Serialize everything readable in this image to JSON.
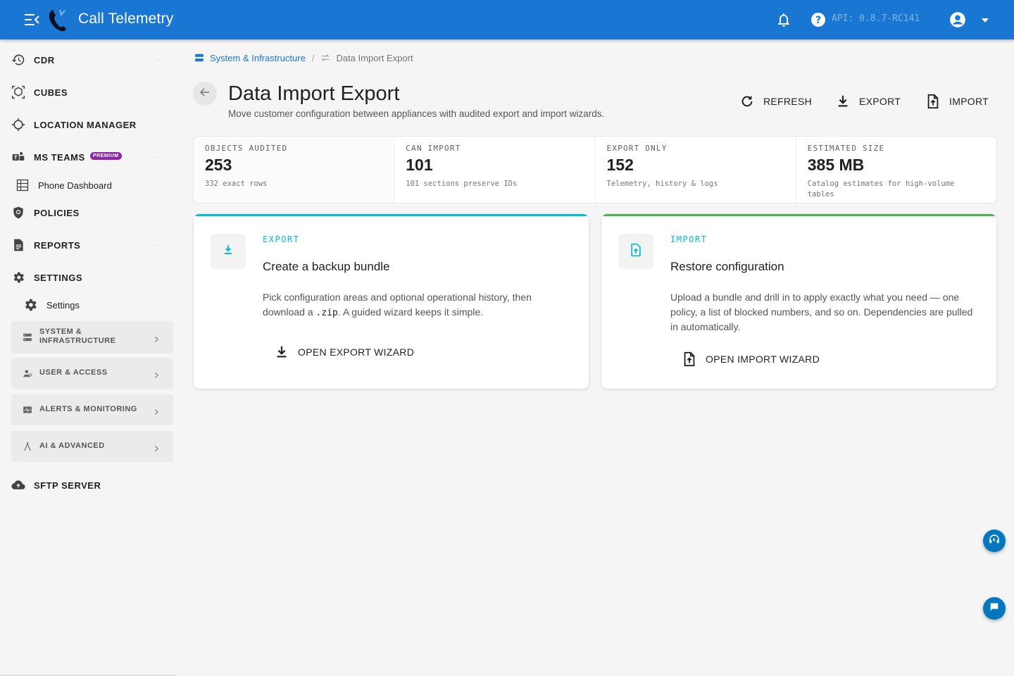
{
  "app": {
    "title": "Call Telemetry",
    "api_version": "API: 0.8.7-RC141"
  },
  "sidebar": {
    "cdr": "CDR",
    "cubes": "CUBES",
    "location_manager": "LOCATION MANAGER",
    "ms_teams": "MS TEAMS",
    "premium_badge": "PREMIUM",
    "phone_dashboard": "Phone Dashboard",
    "policies": "POLICIES",
    "reports": "REPORTS",
    "settings": "SETTINGS",
    "settings_sub": "Settings",
    "groups": [
      {
        "label": "SYSTEM & INFRASTRUCTURE",
        "line1": "SYSTEM &",
        "line2": "INFRASTRUCTURE"
      },
      {
        "label": "USER & ACCESS"
      },
      {
        "label": "ALERTS & MONITORING"
      },
      {
        "label": "AI & ADVANCED"
      }
    ],
    "sftp": "SFTP SERVER"
  },
  "breadcrumb": {
    "parent": "System & Infrastructure",
    "separator": "/",
    "current": "Data Import Export"
  },
  "page": {
    "title": "Data Import Export",
    "subtitle": "Move customer configuration between appliances with audited export and import wizards."
  },
  "actions": {
    "refresh": "REFRESH",
    "export": "EXPORT",
    "import": "IMPORT"
  },
  "stats": [
    {
      "label": "OBJECTS AUDITED",
      "value": "253",
      "note": "332 exact rows"
    },
    {
      "label": "CAN IMPORT",
      "value": "101",
      "note": "101 sections preserve IDs"
    },
    {
      "label": "EXPORT ONLY",
      "value": "152",
      "note": "Telemetry, history & logs"
    },
    {
      "label": "ESTIMATED SIZE",
      "value": "385 MB",
      "note": "Catalog estimates for high-volume tables"
    }
  ],
  "export_card": {
    "eyebrow": "EXPORT",
    "title": "Create a backup bundle",
    "desc_before": "Pick configuration areas and optional operational history, then download a ",
    "desc_code": ".zip",
    "desc_after": ". A guided wizard keeps it simple.",
    "button": "OPEN EXPORT WIZARD"
  },
  "import_card": {
    "eyebrow": "IMPORT",
    "title": "Restore configuration",
    "desc": "Upload a bundle and drill in to apply exactly what you need — one policy, a list of blocked numbers, and so on. Dependencies are pulled in automatically.",
    "button": "OPEN IMPORT WIZARD"
  },
  "colors": {
    "primary": "#1976d2",
    "export_accent": "#00bcd4",
    "import_accent": "#4caf50",
    "premium": "#8e24aa",
    "fab": "#0277bd"
  },
  "icons": [
    "menu-icon",
    "phone-logo-icon",
    "bell-icon",
    "help-icon",
    "account-icon",
    "history-icon",
    "cube-icon",
    "crosshair-icon",
    "teams-icon",
    "grid-icon",
    "shield-icon",
    "report-icon",
    "gear-icon",
    "server-icon",
    "user-icon",
    "monitor-icon",
    "compass-icon",
    "cloud-upload-icon",
    "back-arrow-icon",
    "refresh-icon",
    "download-icon",
    "file-upload-icon",
    "headset-icon",
    "chat-icon"
  ]
}
